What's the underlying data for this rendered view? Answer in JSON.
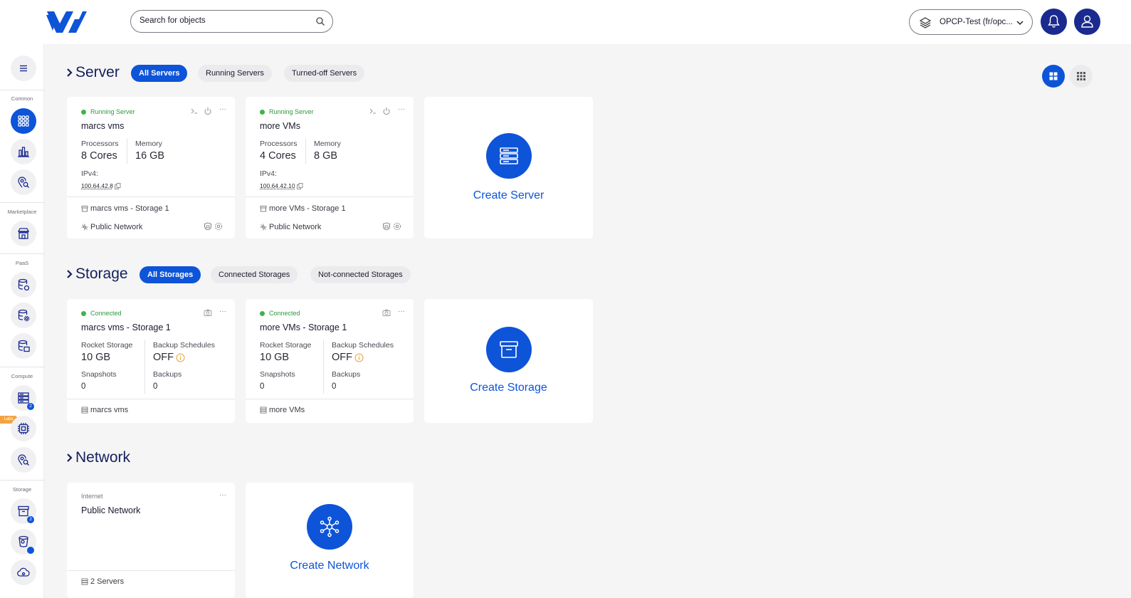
{
  "header": {
    "search_placeholder": "Search for objects",
    "project_label": "OPCP-Test (fr/opc..."
  },
  "sidebar": {
    "groups": [
      "Common",
      "Marketplace",
      "PaaS",
      "Compute",
      "Storage"
    ],
    "labs_badge": "Labs",
    "compute_badge": "2",
    "storage_badge": "2"
  },
  "server_section": {
    "title": "Server",
    "filters": [
      "All Servers",
      "Running Servers",
      "Turned-off Servers"
    ],
    "cards": [
      {
        "status": "Running Server",
        "name": "marcs vms",
        "processors_label": "Processors",
        "processors": "8 Cores",
        "memory_label": "Memory",
        "memory": "16 GB",
        "ipv4_label": "IPv4:",
        "ipv4": "100.64.42.8",
        "storage": "marcs vms - Storage 1",
        "network": "Public Network"
      },
      {
        "status": "Running Server",
        "name": "more VMs",
        "processors_label": "Processors",
        "processors": "4 Cores",
        "memory_label": "Memory",
        "memory": "8 GB",
        "ipv4_label": "IPv4:",
        "ipv4": "100.64.42.10",
        "storage": "more VMs - Storage 1",
        "network": "Public Network"
      }
    ],
    "create_label": "Create Server"
  },
  "storage_section": {
    "title": "Storage",
    "filters": [
      "All Storages",
      "Connected Storages",
      "Not-connected Storages"
    ],
    "cards": [
      {
        "status": "Connected",
        "name": "marcs vms - Storage 1",
        "type_label": "Rocket Storage",
        "size": "10 GB",
        "backup_label": "Backup Schedules",
        "backup": "OFF",
        "snapshots_label": "Snapshots",
        "snapshots": "0",
        "backups_label": "Backups",
        "backups": "0",
        "server": "marcs vms"
      },
      {
        "status": "Connected",
        "name": "more VMs - Storage 1",
        "type_label": "Rocket Storage",
        "size": "10 GB",
        "backup_label": "Backup Schedules",
        "backup": "OFF",
        "snapshots_label": "Snapshots",
        "snapshots": "0",
        "backups_label": "Backups",
        "backups": "0",
        "server": "more VMs"
      }
    ],
    "create_label": "Create Storage"
  },
  "network_section": {
    "title": "Network",
    "cards": [
      {
        "type": "Internet",
        "name": "Public Network",
        "servers": "2 Servers"
      }
    ],
    "create_label": "Create Network"
  },
  "more_symbol": "···",
  "colors": {
    "accent": "#0d54d8",
    "navy": "#1a2a8f",
    "status_green": "#3fb447",
    "labs_orange": "#f4a340"
  }
}
